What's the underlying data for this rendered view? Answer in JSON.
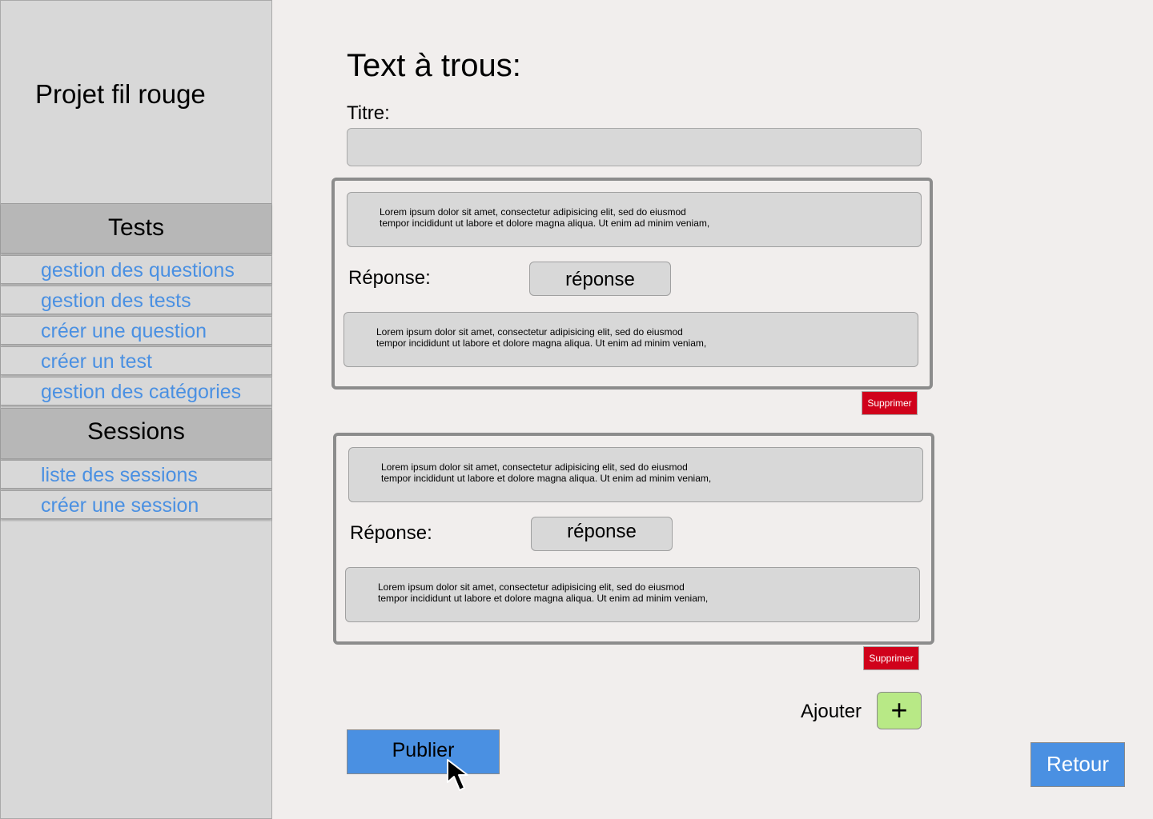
{
  "sidebar": {
    "app_title": "Projet fil rouge",
    "tests_header": "Tests",
    "tests_items": [
      {
        "label": "gestion des questions"
      },
      {
        "label": "gestion des tests"
      },
      {
        "label": "créer une question"
      },
      {
        "label": "créer un test"
      },
      {
        "label": "gestion des catégories"
      }
    ],
    "sessions_header": "Sessions",
    "sessions_items": [
      {
        "label": "liste des sessions"
      },
      {
        "label": "créer une session"
      }
    ]
  },
  "main": {
    "page_title": "Text à trous:",
    "titre_label": "Titre:",
    "titre_value": "",
    "cards": [
      {
        "text_before_1": "Lorem ipsum dolor sit amet, consectetur adipisicing elit, sed do eiusmod",
        "text_before_2": "tempor incididunt ut labore et dolore magna aliqua. Ut enim ad minim veniam,",
        "reponse_label": "Réponse:",
        "reponse_value": "réponse",
        "text_after_1": "Lorem ipsum dolor sit amet, consectetur adipisicing elit, sed do eiusmod",
        "text_after_2": "tempor incididunt ut labore et dolore magna aliqua. Ut enim ad minim veniam,",
        "delete_label": "Supprimer"
      },
      {
        "text_before_1": "Lorem ipsum dolor sit amet, consectetur adipisicing elit, sed do eiusmod",
        "text_before_2": "tempor incididunt ut labore et dolore magna aliqua. Ut enim ad minim veniam,",
        "reponse_label": "Réponse:",
        "reponse_value": "réponse",
        "text_after_1": "Lorem ipsum dolor sit amet, consectetur adipisicing elit, sed do eiusmod",
        "text_after_2": "tempor incididunt ut labore et dolore magna aliqua. Ut enim ad minim veniam,",
        "delete_label": "Supprimer"
      }
    ],
    "ajouter_label": "Ajouter",
    "add_icon": "+",
    "publier_label": "Publier",
    "retour_label": "Retour"
  },
  "colors": {
    "accent_blue": "#4a90e2",
    "delete_red": "#d0021b",
    "add_green": "#b8e986",
    "sidebar_bg": "#d8d8d8",
    "section_header_bg": "#b7b7b7",
    "page_bg": "#f1eeed"
  },
  "icons": {
    "add": "plus-icon",
    "cursor": "mouse-pointer-icon"
  }
}
